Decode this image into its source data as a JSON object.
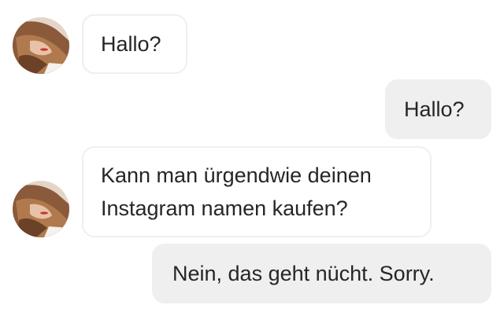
{
  "colors": {
    "incoming_bubble_bg": "#ffffff",
    "incoming_bubble_border": "#efefef",
    "outgoing_bubble_bg": "#efefef",
    "text": "#262626"
  },
  "messages": [
    {
      "direction": "incoming",
      "avatar_icon": "user-avatar-icon",
      "lines": [
        "Hallo?"
      ]
    },
    {
      "direction": "outgoing",
      "lines": [
        "Hallo?"
      ]
    },
    {
      "direction": "incoming",
      "avatar_icon": "user-avatar-icon",
      "lines": [
        "Kann man ürgendwie deinen",
        "Instagram namen kaufen?"
      ]
    },
    {
      "direction": "outgoing",
      "lines": [
        "Nein, das geht nücht. Sorry."
      ]
    }
  ]
}
